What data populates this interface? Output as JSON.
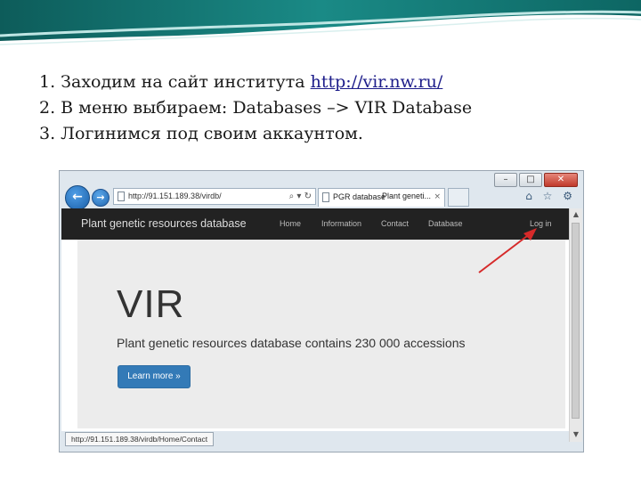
{
  "instructions": [
    {
      "prefix": "1. Заходим на сайт института ",
      "link": "http://vir.nw.ru/"
    },
    {
      "text": "2. В меню выбираем:  Databases –> VIR Database"
    },
    {
      "text": "3. Логинимся под своим аккаунтом."
    }
  ],
  "browser": {
    "window_controls": {
      "minimize": "–",
      "maximize": "□",
      "close": "✕"
    },
    "back_icon": "arrow-left",
    "forward_icon": "arrow-right",
    "address": "http://91.151.189.38/virdb/",
    "address_tools": "⌕ ▾ ↻",
    "tab_title": "PGR database",
    "tab_subtitle": "Plant geneti...",
    "tab_close": "×",
    "toolbar_icons": "⌂ ☆ ⚙",
    "status_url": "http://91.151.189.38/virdb/Home/Contact"
  },
  "site": {
    "brand": "Plant genetic resources database",
    "nav": [
      "Home",
      "Information",
      "Contact",
      "Database"
    ],
    "login": "Log in",
    "title": "VIR",
    "lead": "Plant genetic resources database contains 230 000 accessions",
    "button": "Learn more »"
  },
  "colors": {
    "annotation_arrow": "#d62a2a",
    "navbar": "#222222",
    "primary_button": "#337ab7"
  }
}
